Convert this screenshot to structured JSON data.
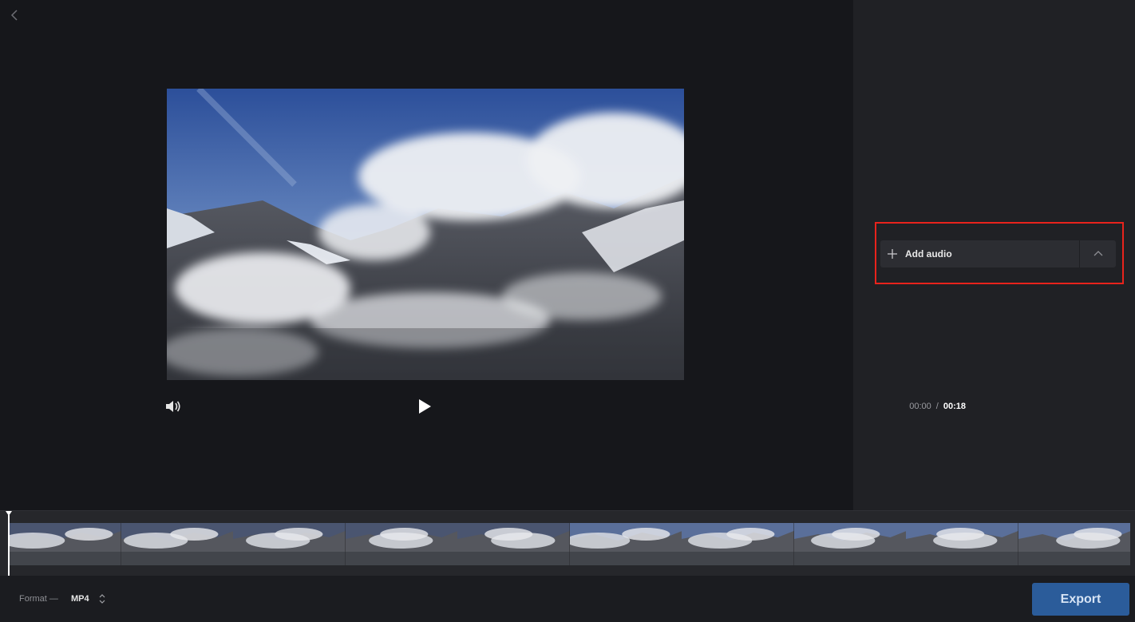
{
  "player": {
    "current_time": "00:00",
    "separator": "/",
    "total_time": "00:18"
  },
  "audio": {
    "add_label": "Add audio"
  },
  "timeline": {
    "frame_count": 10,
    "progress": 0
  },
  "footer": {
    "format_label": "Format —",
    "format_value": "MP4",
    "export_label": "Export"
  },
  "colors": {
    "background": "#16171b",
    "panel": "#202125",
    "highlight": "#e8231c",
    "export": "#2b5c9a"
  },
  "icons": {
    "back": "chevron-left-icon",
    "volume": "speaker-icon",
    "play": "play-icon",
    "add": "plus-icon",
    "expand": "chevron-up-icon",
    "format": "updown-icon"
  }
}
